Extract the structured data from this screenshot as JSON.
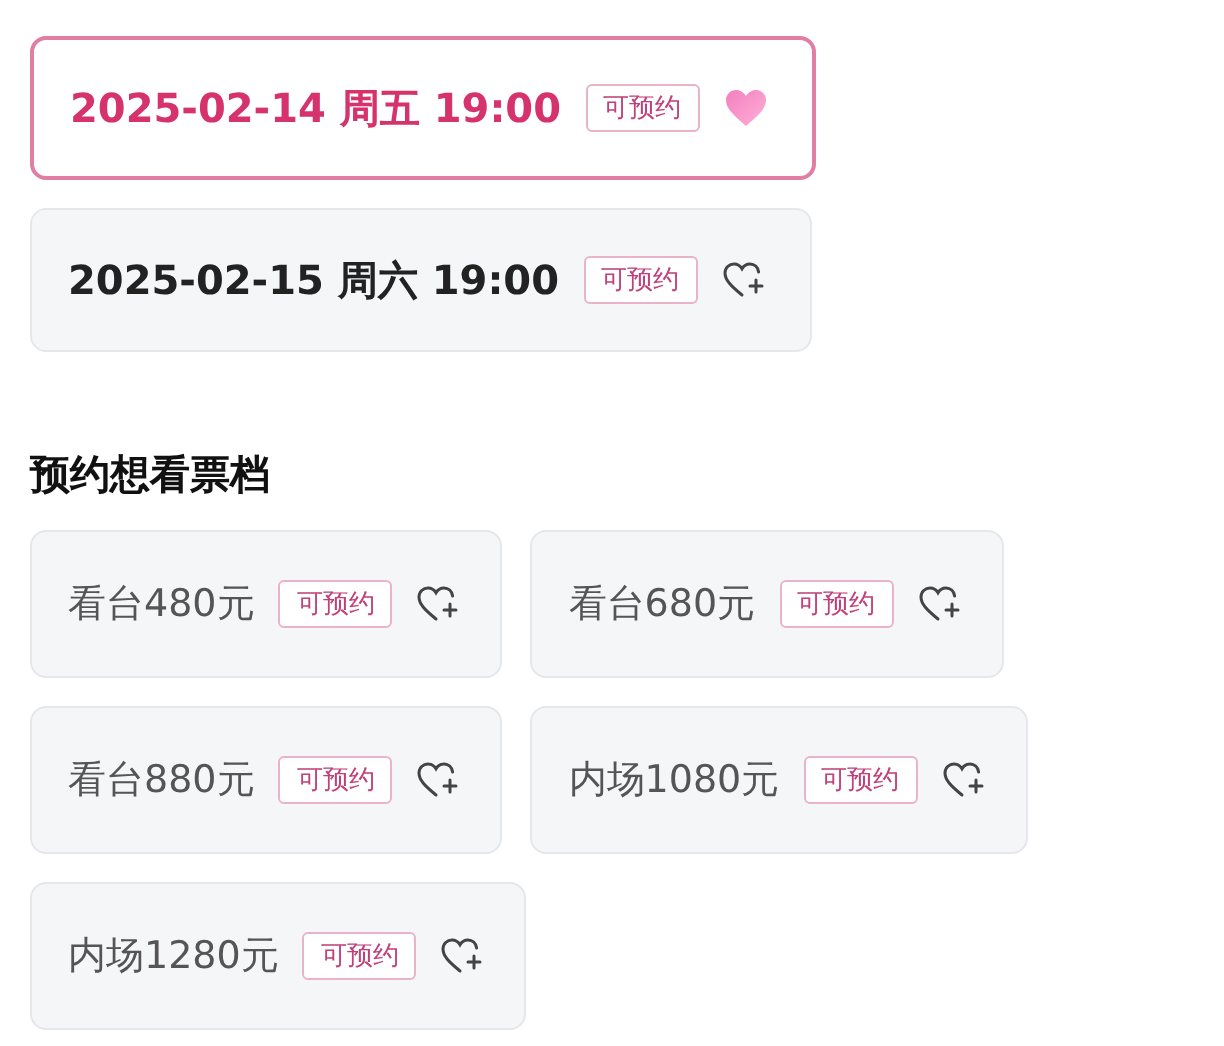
{
  "sessions": [
    {
      "label": "2025-02-14 周五 19:00",
      "tag": "可预约",
      "selected": true,
      "wished": true
    },
    {
      "label": "2025-02-15 周六 19:00",
      "tag": "可预约",
      "selected": false,
      "wished": false
    }
  ],
  "tiers_heading": "预约想看票档",
  "tiers": [
    {
      "label": "看台480元",
      "tag": "可预约",
      "selected": false,
      "wished": false
    },
    {
      "label": "看台680元",
      "tag": "可预约",
      "selected": false,
      "wished": false
    },
    {
      "label": "看台880元",
      "tag": "可预约",
      "selected": false,
      "wished": false
    },
    {
      "label": "内场1080元",
      "tag": "可预约",
      "selected": false,
      "wished": false
    },
    {
      "label": "内场1280元",
      "tag": "可预约",
      "selected": false,
      "wished": false
    }
  ]
}
